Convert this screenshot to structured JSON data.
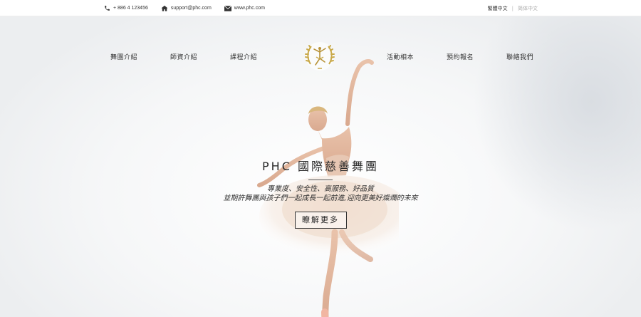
{
  "topbar": {
    "phone": "+ 886 4 123456",
    "email": "support@phc.com",
    "website": "www.phc.com",
    "lang_traditional": "繁體中文",
    "lang_separator": "|",
    "lang_simplified": "简体中文"
  },
  "nav": {
    "items": [
      "舞團介紹",
      "師資介紹",
      "課程介紹",
      "活動相本",
      "預約報名",
      "聯絡我們"
    ]
  },
  "hero": {
    "title": "PHC 國際慈善舞團",
    "subtitle_line1": "專業度、安全性、高服務、好品質",
    "subtitle_line2": "並期許舞團與孩子們一起成長一起前進,迎向更美好燦爛的未來",
    "cta_label": "瞭解更多"
  },
  "colors": {
    "logo_gold": "#c9a94a",
    "text_dark": "#222222"
  },
  "icons": {
    "phone": "phone-icon",
    "home": "home-icon",
    "mail": "mail-icon",
    "logo": "golden-laurel-dancer-logo"
  }
}
